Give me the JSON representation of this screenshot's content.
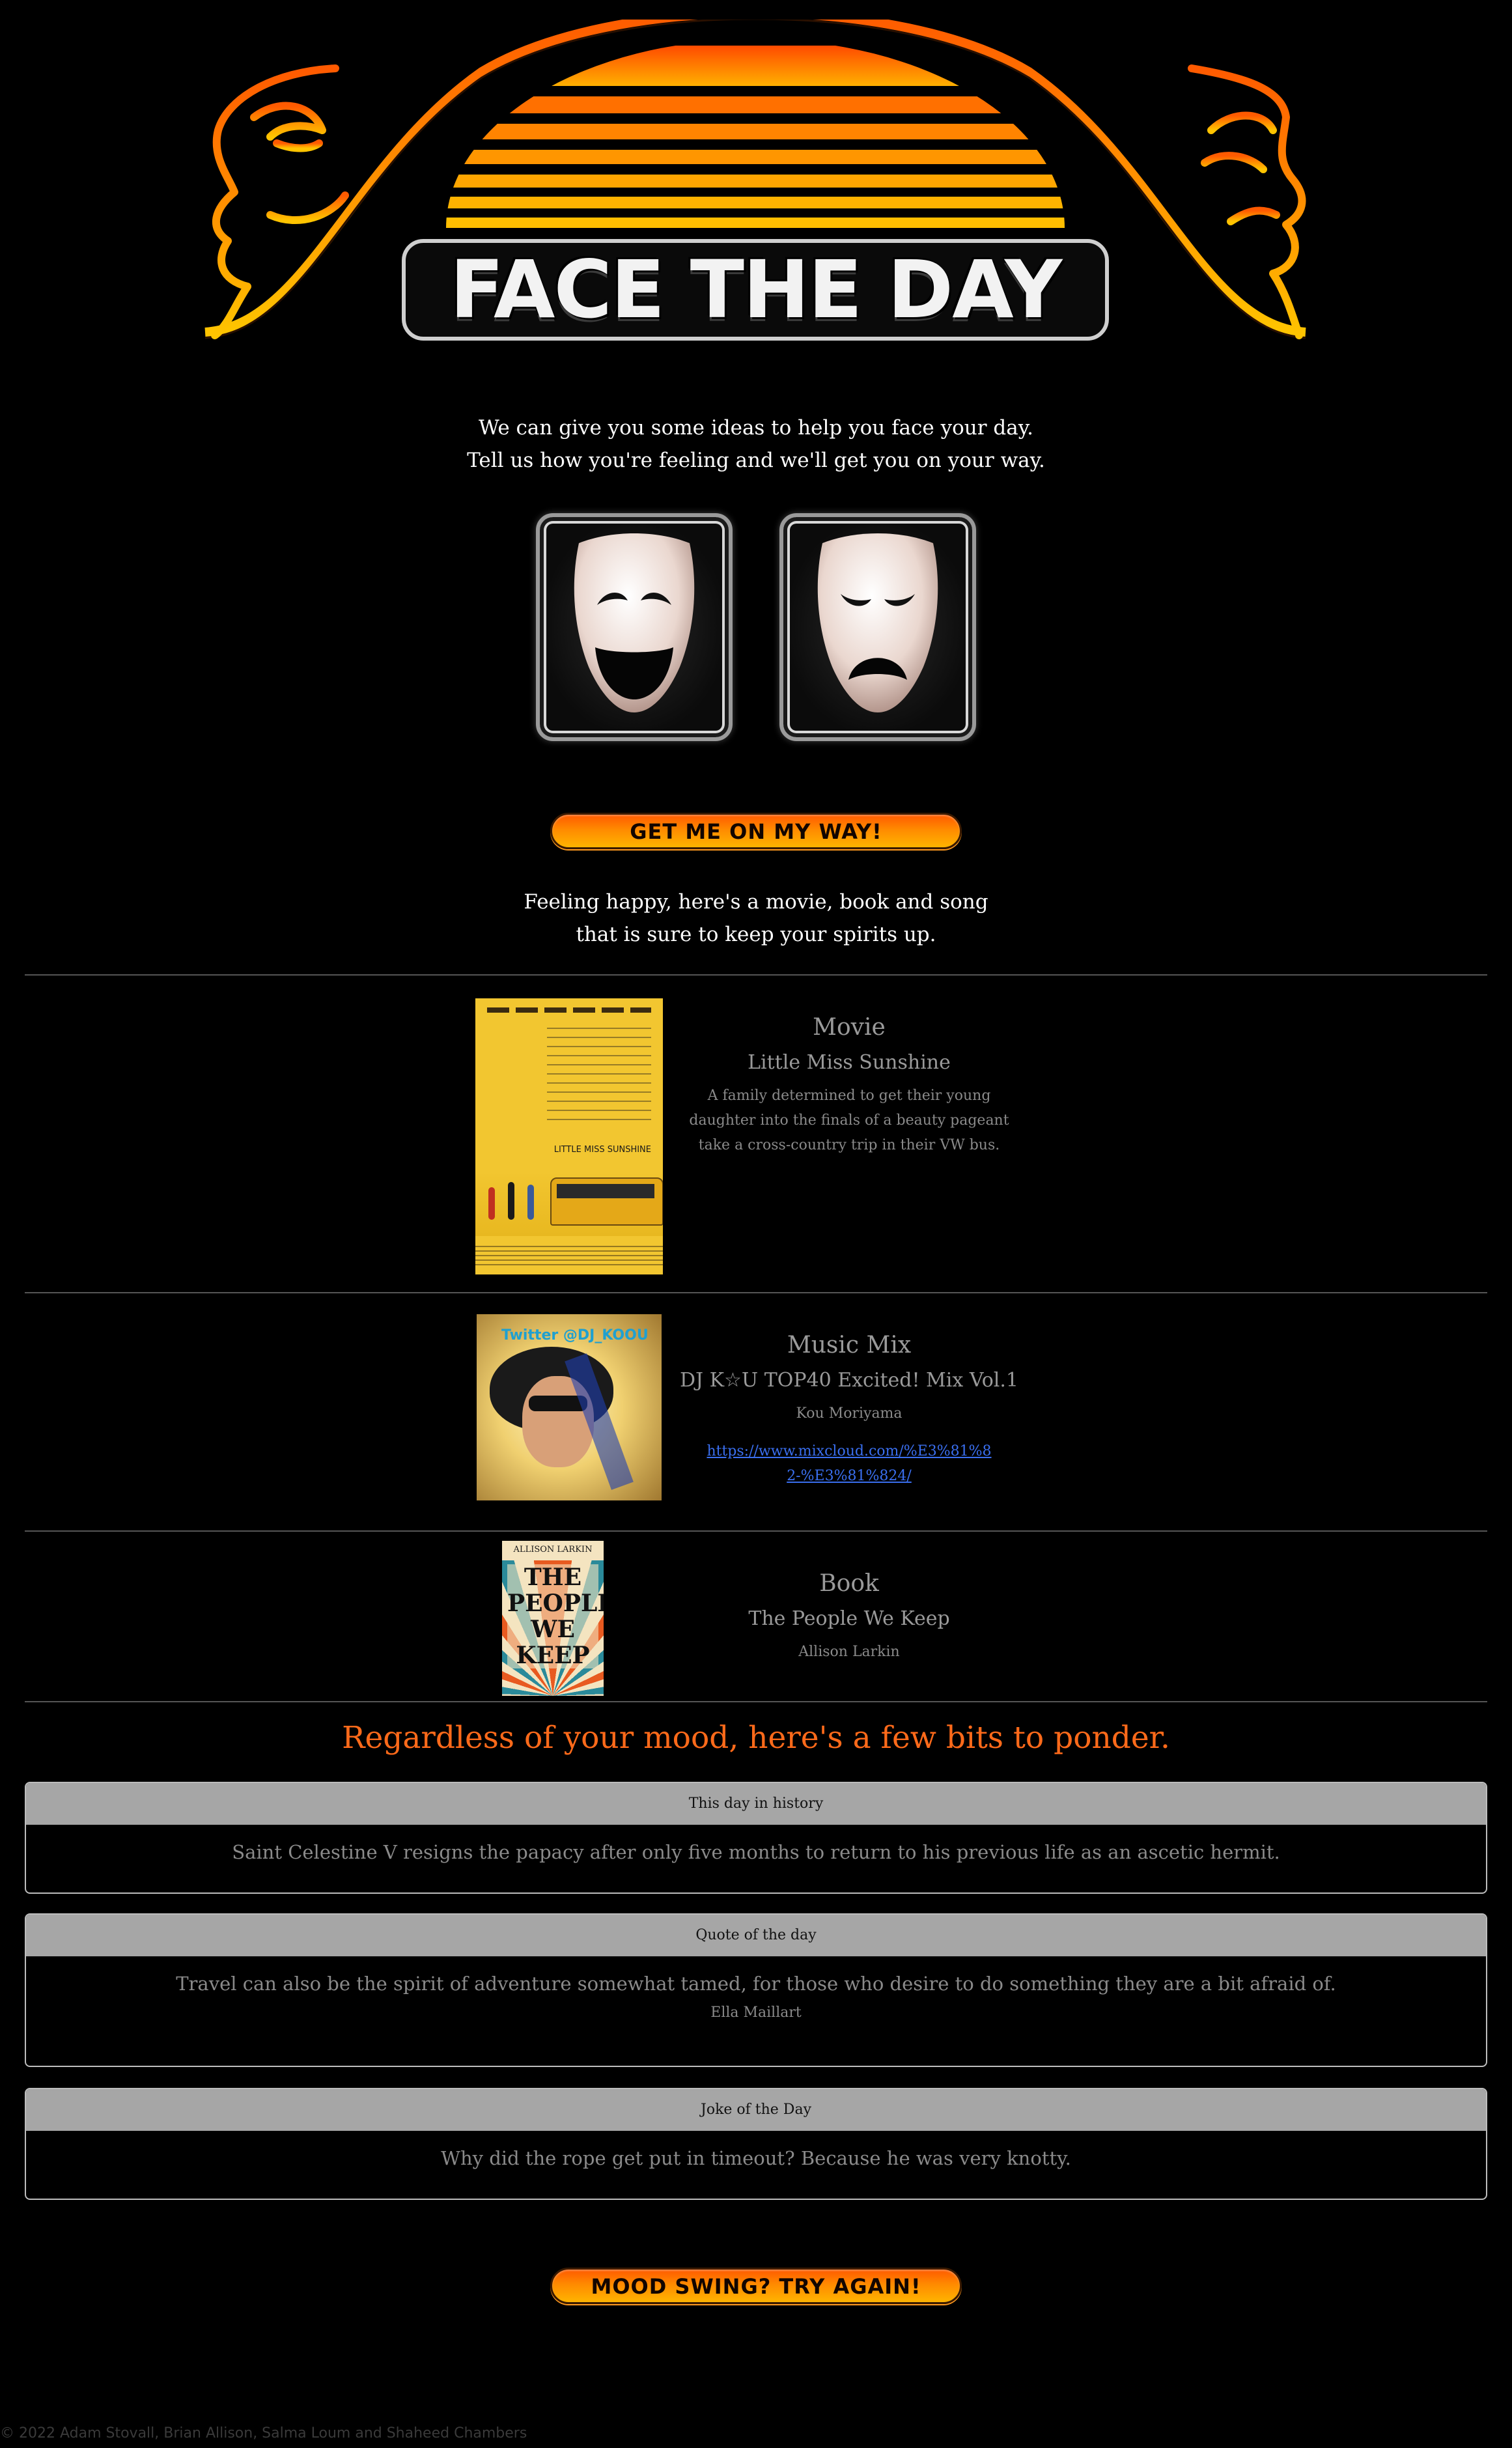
{
  "header": {
    "logo_title": "FACE THE DAY"
  },
  "intro": {
    "line1": "We can give you some ideas to help you face your day.",
    "line2": "Tell us how you're feeling and we'll get you on your way."
  },
  "moods": {
    "happy_icon": "comedy-mask-icon",
    "sad_icon": "tragedy-mask-icon"
  },
  "actions": {
    "get_label": "GET ME ON MY WAY!",
    "retry_label": "MOOD SWING?  TRY AGAIN!"
  },
  "result_intro": {
    "line1": "Feeling happy, here's a movie, book and song",
    "line2": "that is sure to keep your spirits up."
  },
  "movie": {
    "heading": "Movie",
    "title": "Little Miss Sunshine",
    "description": "A family determined to get their young daughter into the finals of a beauty pageant take a cross-country trip in their VW bus.",
    "poster_title": "LITTLE MISS SUNSHINE"
  },
  "music": {
    "heading": "Music Mix",
    "title": "DJ K☆U TOP40 Excited! Mix Vol.1",
    "artist": "Kou Moriyama",
    "link": "https://www.mixcloud.com/%E3%81%82-%E3%81%824/",
    "cover_text": "Twitter @DJ_KOOU"
  },
  "book": {
    "heading": "Book",
    "title": "The People We Keep",
    "author": "Allison Larkin",
    "cover_author": "ALLISON LARKIN",
    "cover_title": "THE PEOPLE WE KEEP"
  },
  "ponder": {
    "title": "Regardless of your mood, here's a few bits to ponder.",
    "history_head": "This day in history",
    "history_text": "Saint Celestine V resigns the papacy after only five months to return to his previous life as an ascetic hermit.",
    "quote_head": "Quote of the day",
    "quote_text": "Travel can also be the spirit of adventure somewhat tamed, for those who desire to do something they are a bit afraid of.",
    "quote_author": "Ella Maillart",
    "joke_head": "Joke of the Day",
    "joke_text": "Why did the rope get put in timeout? Because he was very knotty."
  },
  "footer": {
    "text": "© 2022 Adam Stovall, Brian Allison, Salma Loum and Shaheed Chambers"
  },
  "colors": {
    "accent": "#ff6a1a",
    "link": "#3a6ff0",
    "card_header": "#a6a6a6"
  }
}
